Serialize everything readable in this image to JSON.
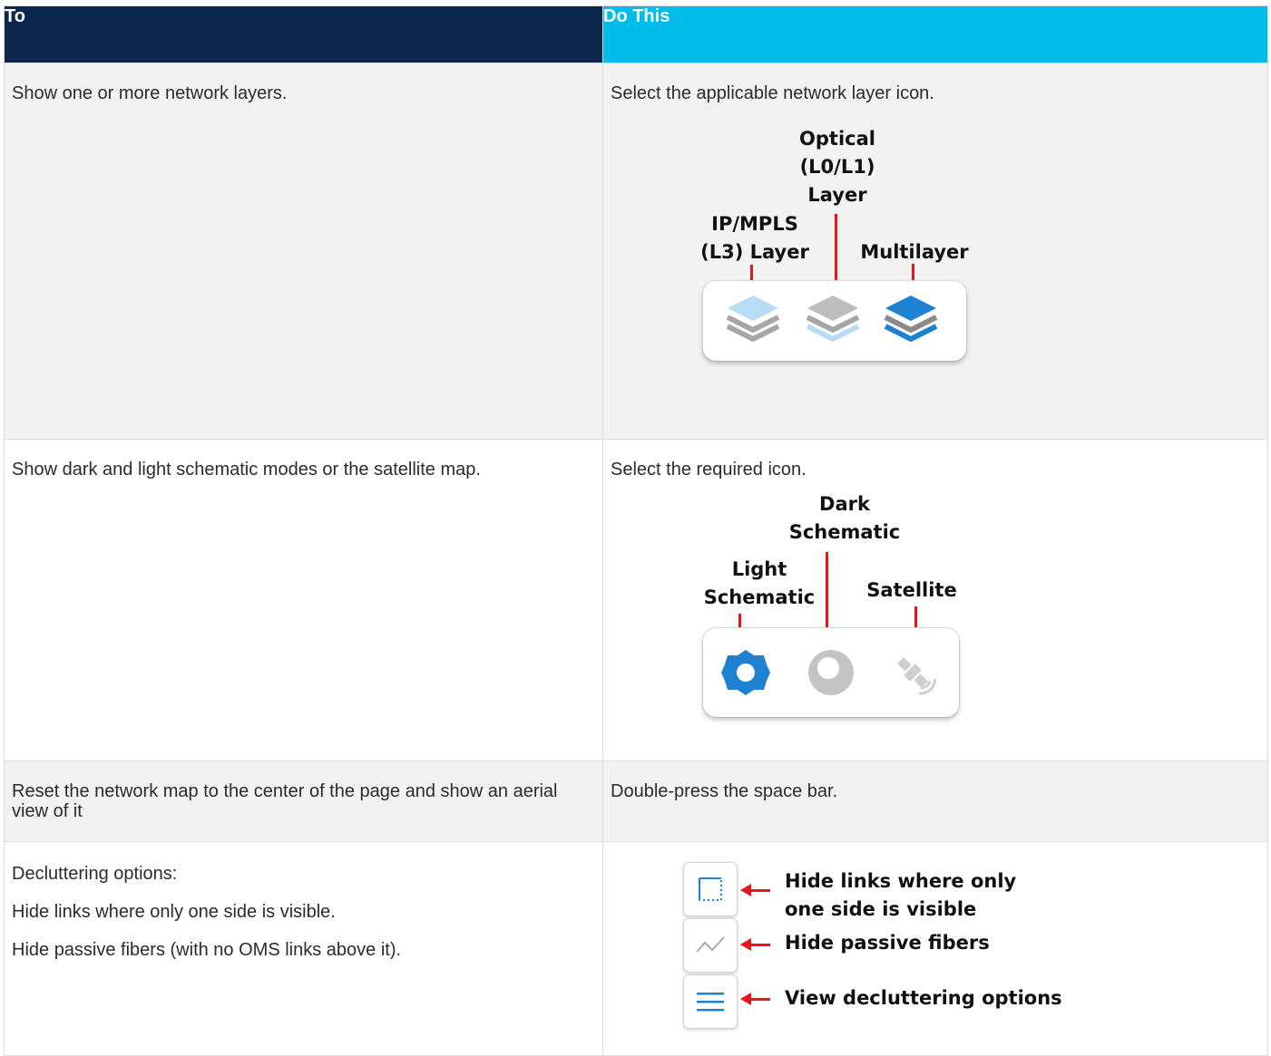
{
  "table": {
    "headers": [
      "To",
      "Do This"
    ],
    "rows": [
      {
        "to": "Show one or more network layers.",
        "do": "Select the applicable network layer icon.",
        "figure": {
          "labels": {
            "ip_mpls": [
              "IP/MPLS",
              "(L3) Layer"
            ],
            "optical": [
              "Optical",
              "(L0/L1)",
              "Layer"
            ],
            "multilayer": "Multilayer"
          },
          "icons": [
            "ip-mpls-layer-icon",
            "optical-layer-icon",
            "multilayer-icon"
          ]
        }
      },
      {
        "to": "Show dark and light schematic modes or the satellite map.",
        "do": "Select the required icon.",
        "figure": {
          "labels": {
            "light": [
              "Light",
              "Schematic"
            ],
            "dark": [
              "Dark",
              "Schematic"
            ],
            "satellite": "Satellite"
          },
          "icons": [
            "light-schematic-icon",
            "dark-schematic-icon",
            "satellite-icon"
          ]
        }
      },
      {
        "to": "Reset the network map to the center of the page and show an aerial view of it",
        "do": "Double-press the space bar."
      },
      {
        "to_lines": [
          "Decluttering options:",
          "Hide links where only one side is visible.",
          "Hide passive fibers (with no OMS links above it)."
        ],
        "figure": {
          "labels": {
            "hide_links": [
              "Hide links where only",
              "one side is visible"
            ],
            "hide_passive": "Hide passive fibers",
            "view_options": "View decluttering options"
          },
          "icons": [
            "hide-one-sided-links-icon",
            "hide-passive-fibers-icon",
            "declutter-menu-icon"
          ]
        }
      }
    ]
  },
  "colors": {
    "header_left": "#0d274d",
    "header_right": "#00bceb",
    "arrow": "#e8141b",
    "icon_blue": "#1e82d2"
  }
}
